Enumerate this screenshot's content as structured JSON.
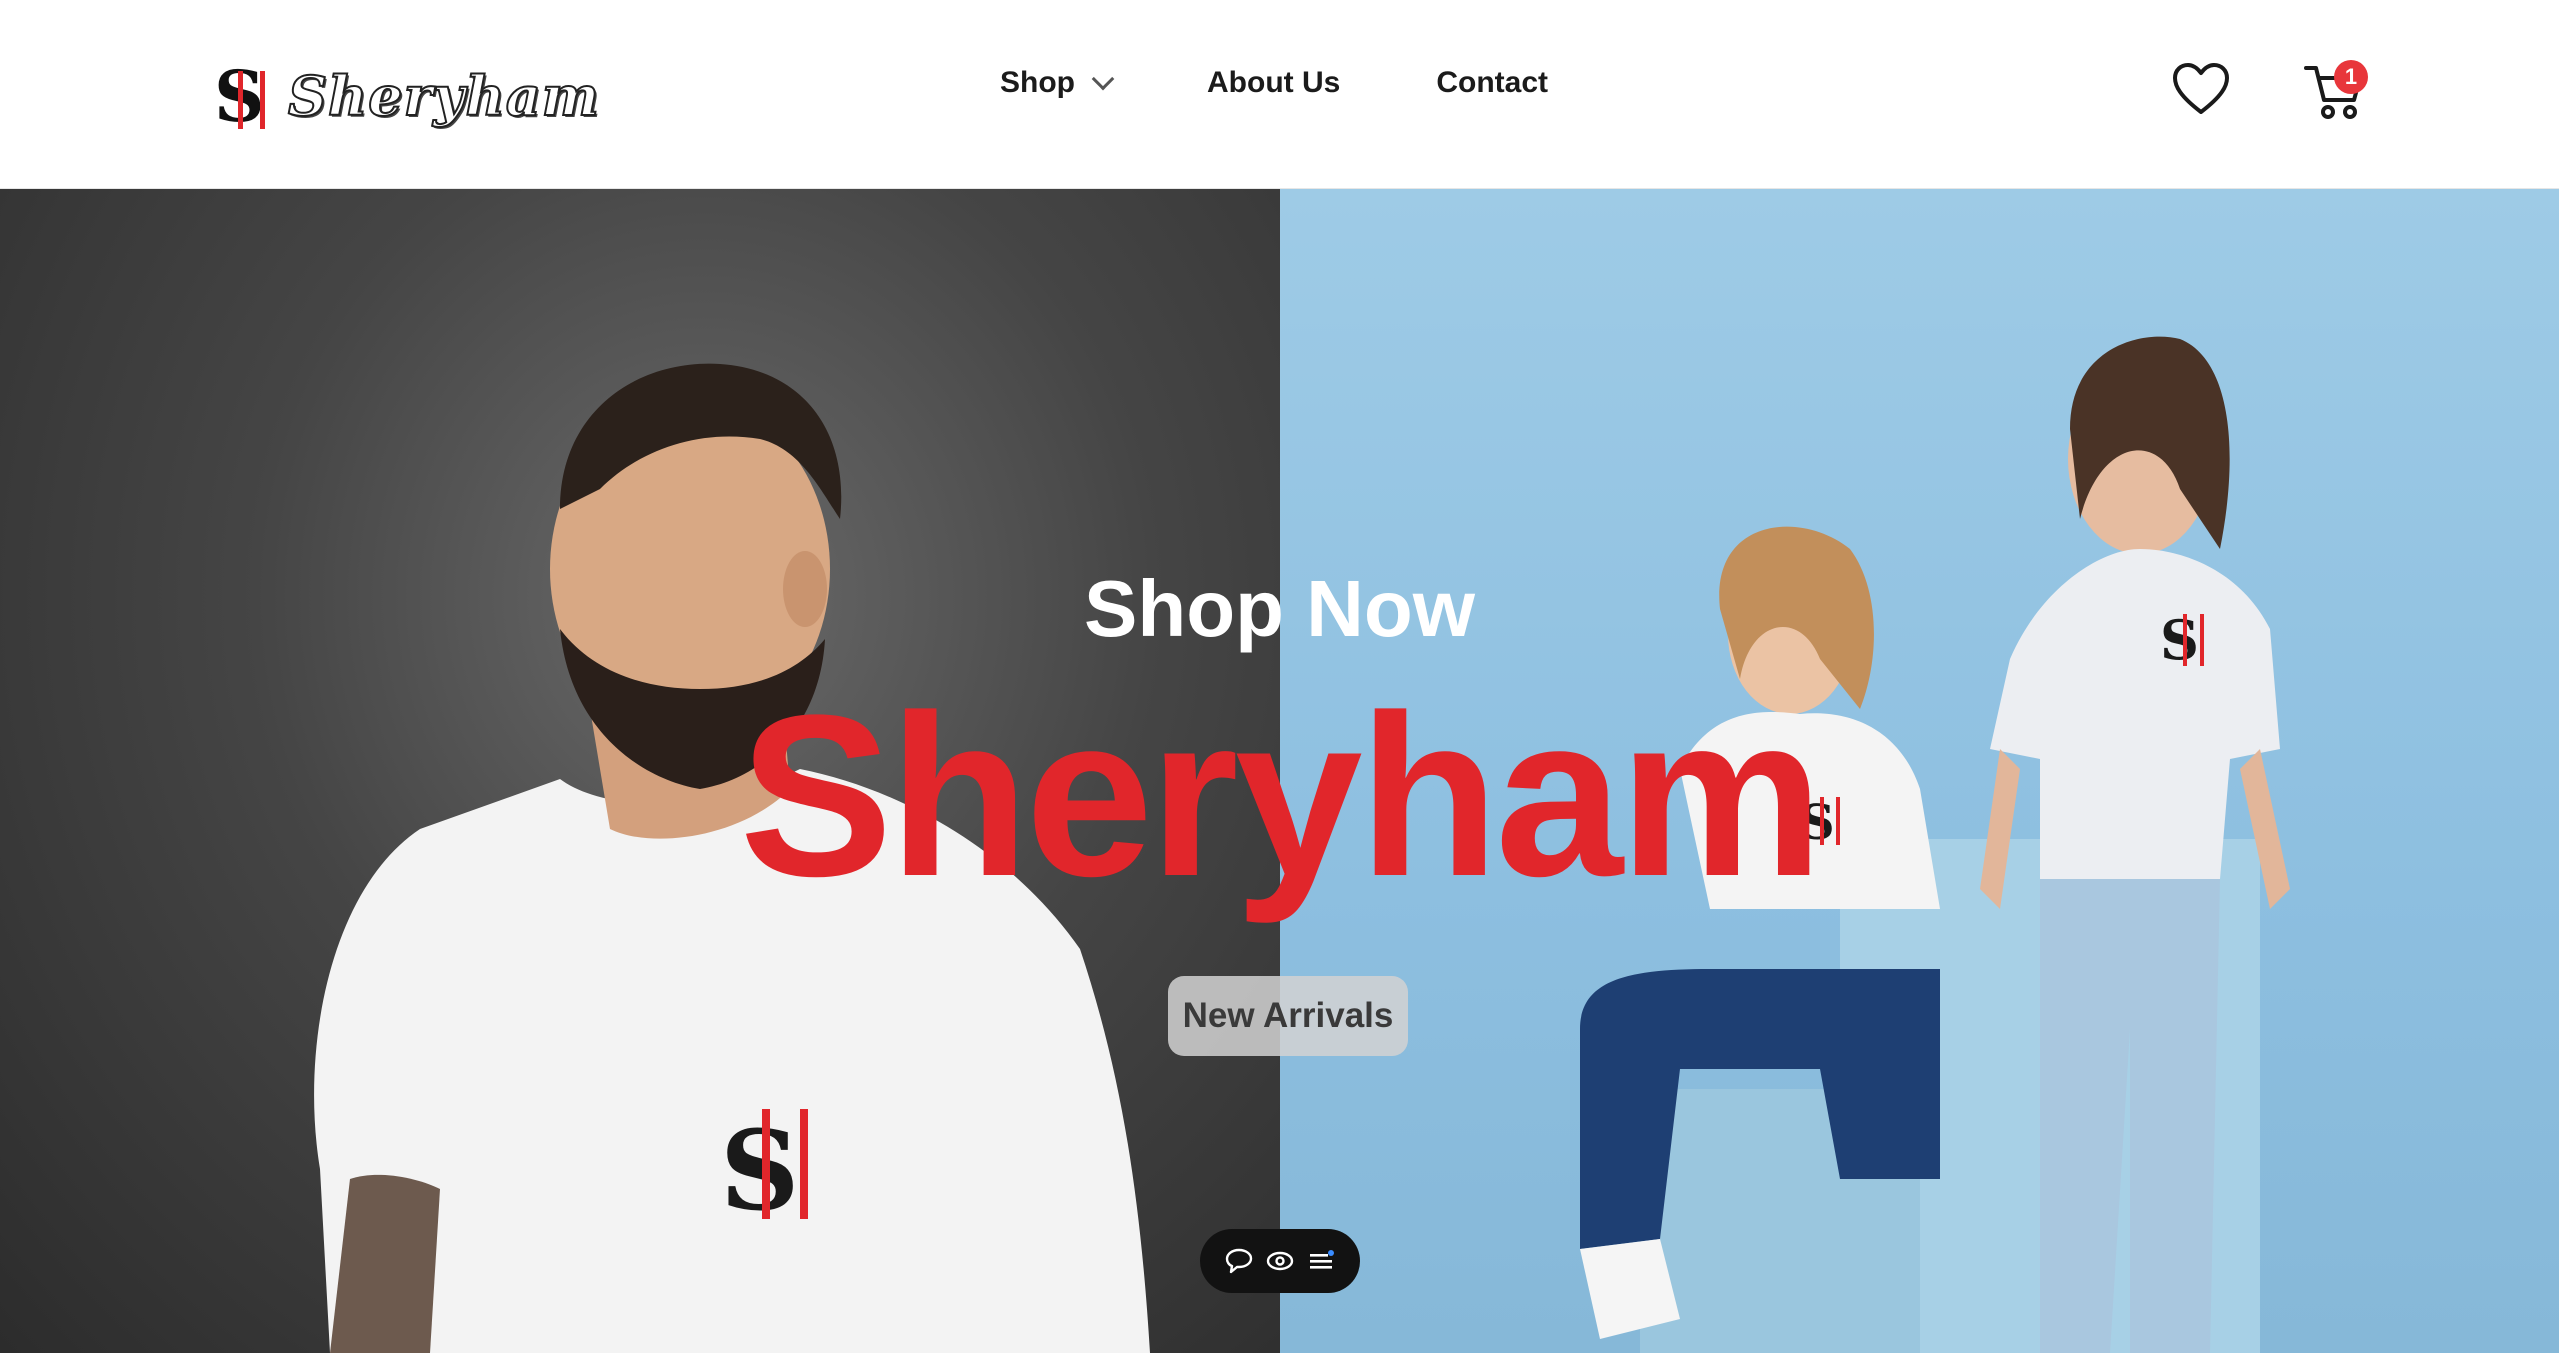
{
  "brand": {
    "logo_monogram": "SH",
    "logo_wordmark": "Sheryham"
  },
  "nav": {
    "shop_label": "Shop",
    "about_label": "About Us",
    "contact_label": "Contact"
  },
  "header_icons": {
    "wishlist_icon": "heart-icon",
    "cart_icon": "cart-icon",
    "cart_count": "1"
  },
  "hero": {
    "kicker": "Shop Now",
    "title": "Sheryham",
    "cta_label": "New Arrivals"
  },
  "toolbar": {
    "items": [
      "chat-icon",
      "eye-icon",
      "menu-icon"
    ]
  },
  "colors": {
    "accent": "#e1262b",
    "badge": "#e8363b",
    "hero_left_bg": "#454545",
    "hero_right_bg": "#8dbfe0"
  }
}
